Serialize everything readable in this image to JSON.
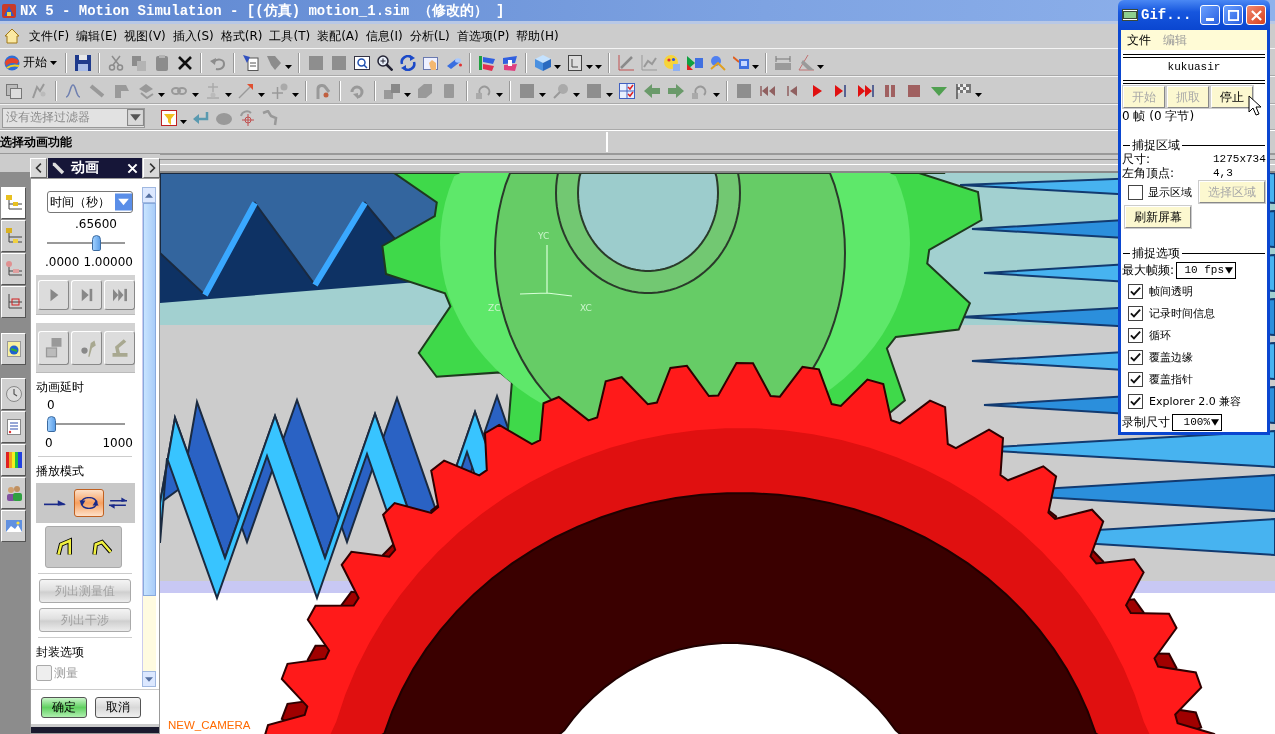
{
  "window": {
    "title": "NX 5 - Motion Simulation - [(仿真) motion_1.sim （修改的） ]"
  },
  "menu_bar": {
    "items": [
      "文件(F)",
      "编辑(E)",
      "视图(V)",
      "插入(S)",
      "格式(R)",
      "工具(T)",
      "装配(A)",
      "信息(I)",
      "分析(L)",
      "首选项(P)",
      "帮助(H)"
    ]
  },
  "toolbar": {
    "start_button": {
      "label": "开始"
    }
  },
  "selection_filter": {
    "value": "没有选择过滤器",
    "disabled": true
  },
  "cue_line": {
    "text": "选择动画功能"
  },
  "resource_bar": {
    "tabs": [
      {
        "selected": true
      },
      {
        "selected": false
      },
      {
        "selected": false
      },
      {
        "selected": false
      },
      {
        "selected": false
      },
      {
        "selected": false
      },
      {
        "selected": false
      },
      {
        "selected": false
      },
      {
        "selected": false
      },
      {
        "selected": false
      }
    ]
  },
  "dialog": {
    "title": "动画",
    "type_dropdown": {
      "value": "时间（秒）"
    },
    "time_slider": {
      "value": ".65600",
      "level": 0.656,
      "min_label": ".0000",
      "max_label": "1.00000"
    },
    "delay": {
      "label": "动画延时",
      "value": "0",
      "level": 0,
      "min_label": "0",
      "max_label": "1000"
    },
    "playback_mode": {
      "label": "播放模式",
      "modes": [
        {
          "kind": "once",
          "selected": false
        },
        {
          "kind": "loop",
          "selected": true
        },
        {
          "kind": "bounce",
          "selected": false
        }
      ]
    },
    "list_buttons": [
      {
        "label": "列出测量值",
        "disabled": true
      },
      {
        "label": "列出干涉",
        "disabled": true
      }
    ],
    "package_options": {
      "label": "封装选项",
      "options": [
        {
          "label": "测量",
          "checked": false,
          "disabled": true
        }
      ]
    },
    "footer_buttons": [
      {
        "label": "确定",
        "kind": "ok"
      },
      {
        "label": "取消",
        "kind": "cancel"
      }
    ]
  },
  "viewport": {
    "triad_labels": [
      "YC",
      "ZC",
      "XC"
    ],
    "camera_label": "NEW_CAMERA"
  },
  "gif_window": {
    "title": "Gif...",
    "menu": [
      {
        "label": "文件",
        "disabled": false
      },
      {
        "label": "编辑",
        "disabled": true
      }
    ],
    "user_name": "kukuasir",
    "buttons": [
      {
        "label": "开始",
        "disabled": true
      },
      {
        "label": "抓取",
        "disabled": true
      },
      {
        "label": "停止",
        "disabled": false
      }
    ],
    "frame_info": "0 帧 (0 字节)",
    "capture_area": {
      "title": "捕捉区域",
      "fields": [
        {
          "label": "尺寸:",
          "value": "1275x734"
        },
        {
          "label": "左角顶点:",
          "value": "4,3"
        }
      ],
      "show_area": {
        "label": "显示区域",
        "checked": false
      },
      "select_button": {
        "label": "选择区域",
        "disabled": true
      },
      "refresh_button": {
        "label": "刷新屏幕"
      }
    },
    "capture_options": {
      "title": "捕捉选项",
      "max_fps": {
        "label": "最大帧频:",
        "value": "10 fps"
      },
      "checkboxes": [
        {
          "label": "帧间透明",
          "checked": true
        },
        {
          "label": "记录时间信息",
          "checked": true
        },
        {
          "label": "循环",
          "checked": true
        },
        {
          "label": "覆盖边缘",
          "checked": true
        },
        {
          "label": "覆盖指针",
          "checked": true
        },
        {
          "label": "Explorer 2.0 兼容",
          "checked": true
        }
      ],
      "record_size": {
        "label": "录制尺寸",
        "value": "100%"
      }
    }
  }
}
